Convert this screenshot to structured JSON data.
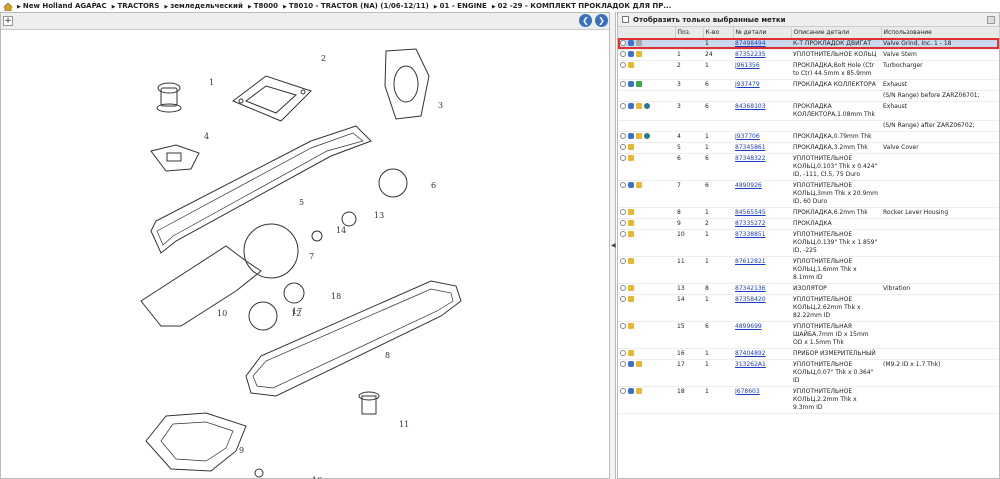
{
  "breadcrumb": [
    "New Holland AGAPAC",
    "TRACTORS",
    "земледельческий",
    "T8000",
    "T8010 - TRACTOR (NA) (1/06-12/11)",
    "01 - ENGINE",
    "02 -29 - КОМПЛЕКТ ПРОКЛАДОК ДЛЯ ПР..."
  ],
  "filter_label": "Отобразить только выбранные метки",
  "columns": [
    "",
    "Поз.",
    "К-во",
    "№ детали",
    "Описание детали",
    "Использование"
  ],
  "diagram_labels": [
    "1",
    "2",
    "3",
    "4",
    "5",
    "6",
    "7",
    "8",
    "9",
    "10",
    "11",
    "12",
    "13",
    "14",
    "15",
    "16",
    "17",
    "18"
  ],
  "rows": [
    {
      "icons": [
        "circ",
        "hand",
        "wrench"
      ],
      "pos": "",
      "qty": "1",
      "part": "87498494",
      "desc": "К-Т ПРОКЛАДОК ДВИГАТ",
      "use": "Valve Grind, Inc. 1 - 18",
      "selected": true
    },
    {
      "icons": [
        "circ",
        "hand",
        "box"
      ],
      "pos": "1",
      "qty": "24",
      "part": "87352235",
      "desc": "УПЛОТНИТЕЛЬНОЕ КОЛЬЦ",
      "use": "Valve Stem"
    },
    {
      "icons": [
        "circ",
        "box"
      ],
      "pos": "2",
      "qty": "1",
      "part": "J961356",
      "desc": "ПРОКЛАДКА,Bolt Hole (Ctr to Ctr) 44.5mm x 85.9mm",
      "use": "Turbocharger"
    },
    {
      "icons": [
        "circ",
        "hand",
        "arrow"
      ],
      "pos": "3",
      "qty": "6",
      "part": "J937479",
      "desc": "ПРОКЛАДКА КОЛЛЕКТОРА",
      "use": "Exhaust",
      "sub": "(S/N Range) before ZARZ06701;"
    },
    {
      "icons": [
        "circ",
        "hand",
        "box",
        "globe"
      ],
      "pos": "3",
      "qty": "6",
      "part": "84368103",
      "desc": "ПРОКЛАДКА КОЛЛЕКТОРА,1.08mm Thk",
      "use": "Exhaust",
      "sub": "(S/N Range) after ZARZ06702;"
    },
    {
      "icons": [
        "circ",
        "hand",
        "box",
        "globe"
      ],
      "pos": "4",
      "qty": "1",
      "part": "J937706",
      "desc": "ПРОКЛАДКА,0.79mm Thk",
      "use": ""
    },
    {
      "icons": [
        "circ",
        "box"
      ],
      "pos": "5",
      "qty": "1",
      "part": "87345861",
      "desc": "ПРОКЛАДКА,3.2mm Thk",
      "use": "Valve Cover"
    },
    {
      "icons": [
        "circ",
        "box"
      ],
      "pos": "6",
      "qty": "6",
      "part": "87348322",
      "desc": "УПЛОТНИТЕЛЬНОЕ КОЛЬЦ,0.103\" Thk x 0.424\" ID, -111, Cl.5, 75 Duro",
      "use": ""
    },
    {
      "icons": [
        "circ",
        "hand",
        "box"
      ],
      "pos": "7",
      "qty": "6",
      "part": "4890926",
      "desc": "УПЛОТНИТЕЛЬНОЕ КОЛЬЦ,3mm Thk x 20.9mm ID, 60 Duro",
      "use": ""
    },
    {
      "icons": [
        "circ",
        "box"
      ],
      "pos": "8",
      "qty": "1",
      "part": "84565545",
      "desc": "ПРОКЛАДКА,6.2mm Thk",
      "use": "Rocker Lever Housing"
    },
    {
      "icons": [
        "circ",
        "box"
      ],
      "pos": "9",
      "qty": "2",
      "part": "87335272",
      "desc": "ПРОКЛАДКА",
      "use": ""
    },
    {
      "icons": [
        "circ",
        "box"
      ],
      "pos": "10",
      "qty": "1",
      "part": "87338851",
      "desc": "УПЛОТНИТЕЛЬНОЕ КОЛЬЦ,0.139\" Thk x 1.859\" ID, -225",
      "use": ""
    },
    {
      "icons": [
        "circ",
        "box"
      ],
      "pos": "11",
      "qty": "1",
      "part": "87612821",
      "desc": "УПЛОТНИТЕЛЬНОЕ КОЛЬЦ,1.6mm Thk x 8.1mm ID",
      "use": ""
    },
    {
      "icons": [
        "circ",
        "box"
      ],
      "pos": "13",
      "qty": "8",
      "part": "87342136",
      "desc": "ИЗОЛЯТОР",
      "use": "Vibration"
    },
    {
      "icons": [
        "circ",
        "box"
      ],
      "pos": "14",
      "qty": "1",
      "part": "87358420",
      "desc": "УПЛОТНИТЕЛЬНОЕ КОЛЬЦ,2.62mm Thk x 82.22mm ID",
      "use": ""
    },
    {
      "icons": [
        "circ",
        "box"
      ],
      "pos": "15",
      "qty": "6",
      "part": "4899699",
      "desc": "УПЛОТНИТЕЛЬНАЯ ШАЙБА,7mm ID x 15mm OD x 1.5mm Thk",
      "use": ""
    },
    {
      "icons": [
        "circ",
        "box"
      ],
      "pos": "16",
      "qty": "1",
      "part": "87404892",
      "desc": "ПРИБОР ИЗМЕРИТЕЛЬНЫЙ",
      "use": ""
    },
    {
      "icons": [
        "circ",
        "hand",
        "box"
      ],
      "pos": "17",
      "qty": "1",
      "part": "313262A1",
      "desc": "УПЛОТНИТЕЛЬНОЕ КОЛЬЦ,0.07\" Thk x 0.364\" ID",
      "use": "(M9.2 ID x 1.7 Thk)"
    },
    {
      "icons": [
        "circ",
        "hand",
        "box"
      ],
      "pos": "18",
      "qty": "1",
      "part": "J678603",
      "desc": "УПЛОТНИТЕЛЬНОЕ КОЛЬЦ,2.2mm Thk x 9.3mm ID",
      "use": ""
    }
  ]
}
